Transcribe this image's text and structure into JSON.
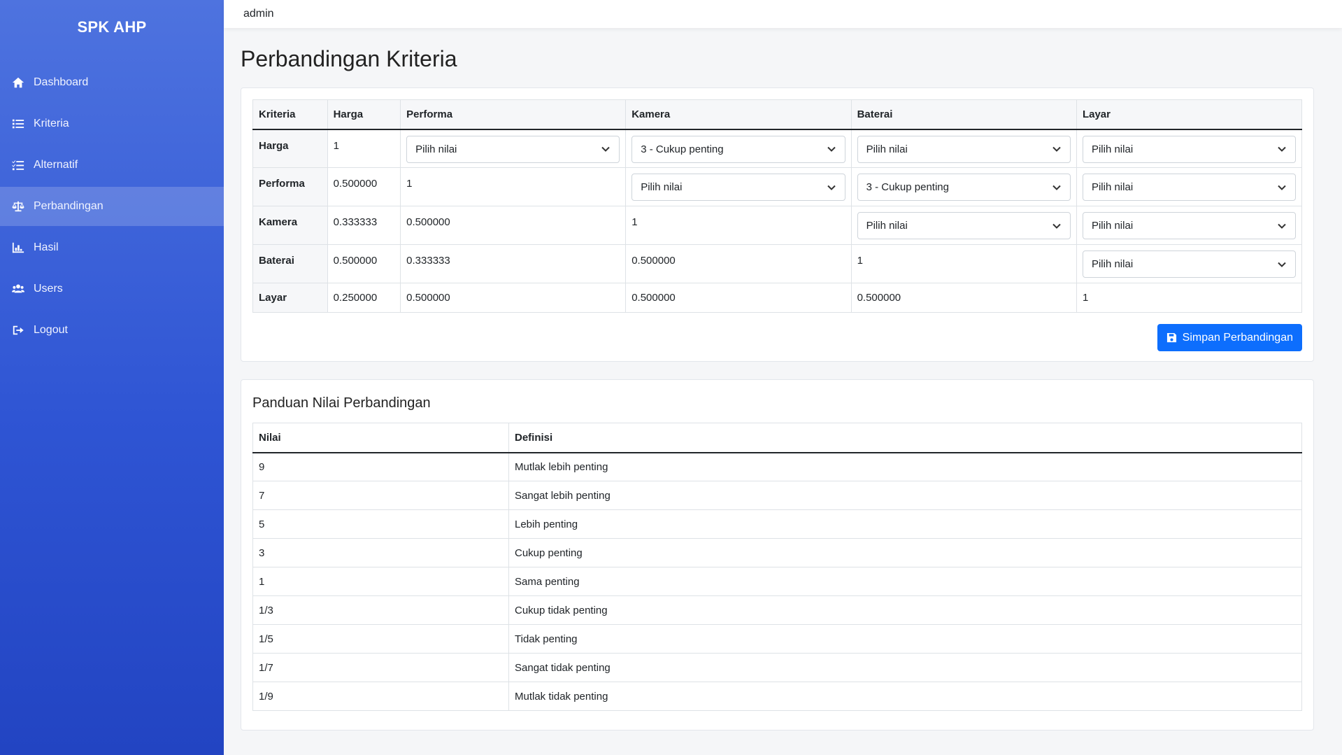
{
  "app": {
    "brand": "SPK AHP",
    "user": "admin"
  },
  "sidebar": {
    "items": [
      {
        "label": "Dashboard",
        "icon": "home-icon"
      },
      {
        "label": "Kriteria",
        "icon": "list-icon"
      },
      {
        "label": "Alternatif",
        "icon": "checklist-icon"
      },
      {
        "label": "Perbandingan",
        "icon": "balance-scale-icon"
      },
      {
        "label": "Hasil",
        "icon": "chart-icon"
      },
      {
        "label": "Users",
        "icon": "users-icon"
      },
      {
        "label": "Logout",
        "icon": "logout-icon"
      }
    ],
    "active": "Perbandingan"
  },
  "page": {
    "title": "Perbandingan Kriteria"
  },
  "comparison": {
    "headers": [
      "Kriteria",
      "Harga",
      "Performa",
      "Kamera",
      "Baterai",
      "Layar"
    ],
    "rows": [
      {
        "name": "Harga",
        "cells": [
          "1",
          "Pilih nilai",
          "3 - Cukup penting",
          "Pilih nilai",
          "Pilih nilai"
        ]
      },
      {
        "name": "Performa",
        "cells": [
          "0.500000",
          "1",
          "Pilih nilai",
          "3 - Cukup penting",
          "Pilih nilai"
        ]
      },
      {
        "name": "Kamera",
        "cells": [
          "0.333333",
          "0.500000",
          "1",
          "Pilih nilai",
          "Pilih nilai"
        ]
      },
      {
        "name": "Baterai",
        "cells": [
          "0.500000",
          "0.333333",
          "0.500000",
          "1",
          "Pilih nilai"
        ]
      },
      {
        "name": "Layar",
        "cells": [
          "0.250000",
          "0.500000",
          "0.500000",
          "0.500000",
          "1"
        ]
      }
    ],
    "save_label": "Simpan Perbandingan"
  },
  "guide": {
    "title": "Panduan Nilai Perbandingan",
    "headers": [
      "Nilai",
      "Definisi"
    ],
    "rows": [
      [
        "9",
        "Mutlak lebih penting"
      ],
      [
        "7",
        "Sangat lebih penting"
      ],
      [
        "5",
        "Lebih penting"
      ],
      [
        "3",
        "Cukup penting"
      ],
      [
        "1",
        "Sama penting"
      ],
      [
        "1/3",
        "Cukup tidak penting"
      ],
      [
        "1/5",
        "Tidak penting"
      ],
      [
        "1/7",
        "Sangat tidak penting"
      ],
      [
        "1/9",
        "Mutlak tidak penting"
      ]
    ]
  }
}
